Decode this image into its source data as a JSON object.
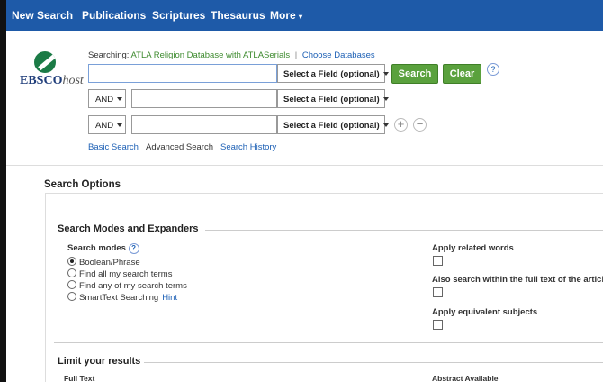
{
  "nav": {
    "items": [
      "New Search",
      "Publications",
      "Scriptures",
      "Thesaurus",
      "More"
    ]
  },
  "logo": {
    "brand": "EBSCO",
    "suffix": "host"
  },
  "searching": {
    "prefix": "Searching:",
    "database": "ATLA Religion Database with ATLASerials",
    "choose": "Choose Databases"
  },
  "search_rows": [
    {
      "bool": "",
      "query": "",
      "field": "Select a Field (optional)"
    },
    {
      "bool": "AND",
      "query": "",
      "field": "Select a Field (optional)"
    },
    {
      "bool": "AND",
      "query": "",
      "field": "Select a Field (optional)"
    }
  ],
  "buttons": {
    "search": "Search",
    "clear": "Clear",
    "help": "?",
    "add": "+",
    "remove": "−"
  },
  "links": {
    "basic": "Basic Search",
    "advanced": "Advanced Search",
    "history": "Search History"
  },
  "search_options": {
    "title": "Search Options",
    "modes_section": "Search Modes and Expanders",
    "modes_label": "Search modes",
    "modes": [
      "Boolean/Phrase",
      "Find all my search terms",
      "Find any of my search terms",
      "SmartText Searching"
    ],
    "selected_mode": "Boolean/Phrase",
    "hint": "Hint",
    "expanders": [
      "Apply related words",
      "Also search within the full text of the articles",
      "Apply equivalent subjects"
    ],
    "limit_section": "Limit your results",
    "full_text": "Full Text",
    "abstract_available": "Abstract Available"
  },
  "colors": {
    "nav_bg": "#1e5aa8",
    "green_button": "#5aa13d",
    "link": "#1d60b5",
    "database_text": "#3d8a2e"
  }
}
